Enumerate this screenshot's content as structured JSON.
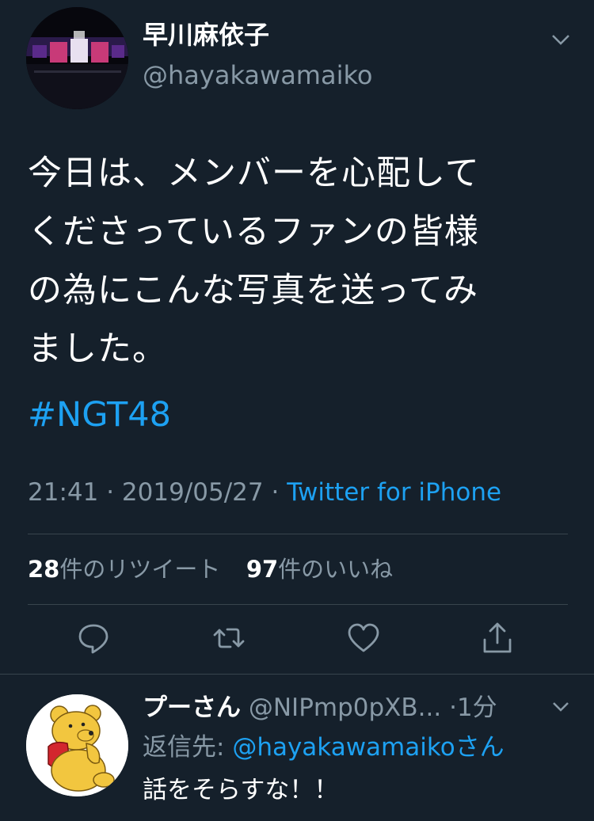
{
  "tweet": {
    "author": {
      "display_name": "早川麻依子",
      "handle": "@hayakawamaiko",
      "avatar_icon": "stage-photo-avatar"
    },
    "text_lines": [
      "今日は、メンバーを心配して",
      "くださっているファンの皆様",
      "の為にこんな写真を送ってみ",
      "ました。"
    ],
    "hashtag": "#NGT48",
    "time": "21:41",
    "date": "2019/05/27",
    "separator": "·",
    "source": "Twitter for iPhone",
    "retweet_count": "28",
    "retweet_label": "件のリツイート",
    "like_count": "97",
    "like_label": "件のいいね",
    "actions": {
      "reply": "reply-icon",
      "retweet": "retweet-icon",
      "like": "heart-icon",
      "share": "share-icon"
    }
  },
  "reply": {
    "display_name": "プーさん",
    "handle": "@NIPmp0pXB...",
    "time": "·1分",
    "reply_to_label": "返信先:",
    "reply_to_handle": "@hayakawamaiko",
    "reply_to_suffix": "さん",
    "text": "話をそらすな！！",
    "avatar_icon": "pooh-bear-avatar"
  },
  "colors": {
    "background": "#15202b",
    "accent": "#1da1f2",
    "secondary_text": "#8899a6",
    "divider": "#38444d"
  }
}
